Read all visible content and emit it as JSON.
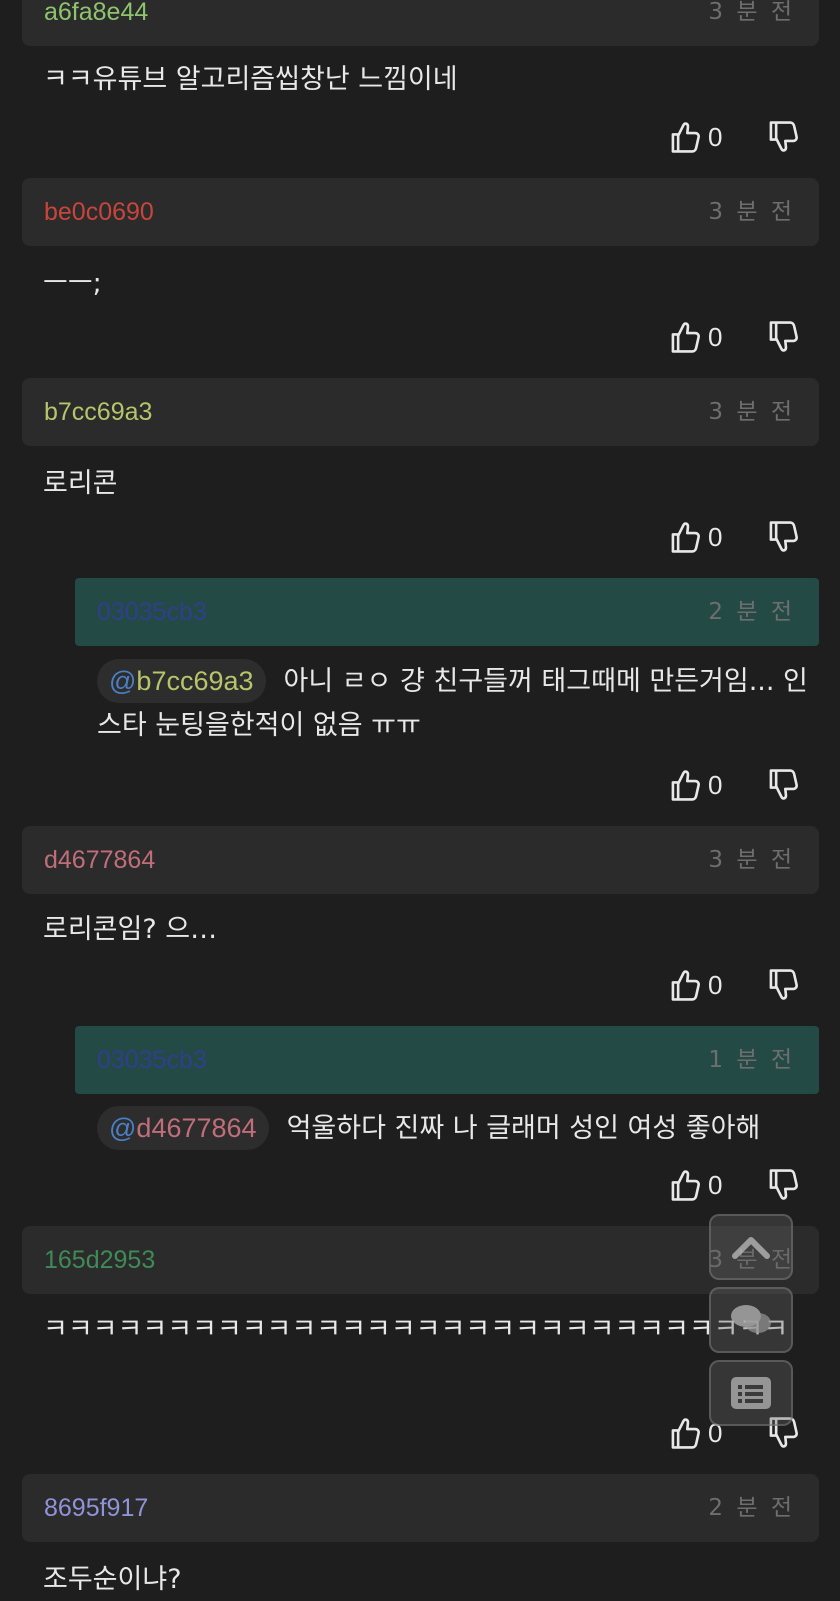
{
  "comments": [
    {
      "user": "a6fa8e44",
      "user_color": "#8fc46e",
      "time": "3 분 전",
      "text": "ㅋㅋ유튜브 알고리즘씹창난 느낌이네",
      "likes": "0"
    },
    {
      "user": "be0c0690",
      "user_color": "#c8453c",
      "time": "3 분 전",
      "text": "ㅡㅡ;",
      "likes": "0"
    },
    {
      "user": "b7cc69a3",
      "user_color": "#b7c46a",
      "time": "3 분 전",
      "text": "로리콘",
      "likes": "0"
    },
    {
      "user": "03035cb3",
      "user_color": "#2f3f8c",
      "time": "2 분 전",
      "mention": "b7cc69a3",
      "mention_color": "#b7c46a",
      "text": "아니 ㄹㅇ 걍 친구들꺼 태그때메 만든거임... 인스타 눈팅을한적이 없음 ㅠㅠ",
      "likes": "0",
      "reply": true
    },
    {
      "user": "d4677864",
      "user_color": "#c06e79",
      "time": "3 분 전",
      "text": "로리콘임? 으…",
      "likes": "0"
    },
    {
      "user": "03035cb3",
      "user_color": "#2f3f8c",
      "time": "1 분 전",
      "mention": "d4677864",
      "mention_color": "#c06e79",
      "text": "억울하다 진짜 나 글래머 성인 여성 좋아해",
      "likes": "0",
      "reply": true
    },
    {
      "user": "165d2953",
      "user_color": "#3f8a57",
      "time": "3 분 전",
      "text": "ㅋㅋㅋㅋㅋㅋㅋㅋㅋㅋㅋㅋㅋㅋㅋㅋㅋㅋㅋㅋㅋㅋㅋㅋㅋㅋㅋㅋㅋㅋ",
      "likes": "0"
    },
    {
      "user": "8695f917",
      "user_color": "#8f93d8",
      "time": "2 분 전",
      "text": "조두순이냐?"
    }
  ],
  "mention_prefix": "@",
  "float_buttons": [
    "scroll-top",
    "comments",
    "list"
  ]
}
